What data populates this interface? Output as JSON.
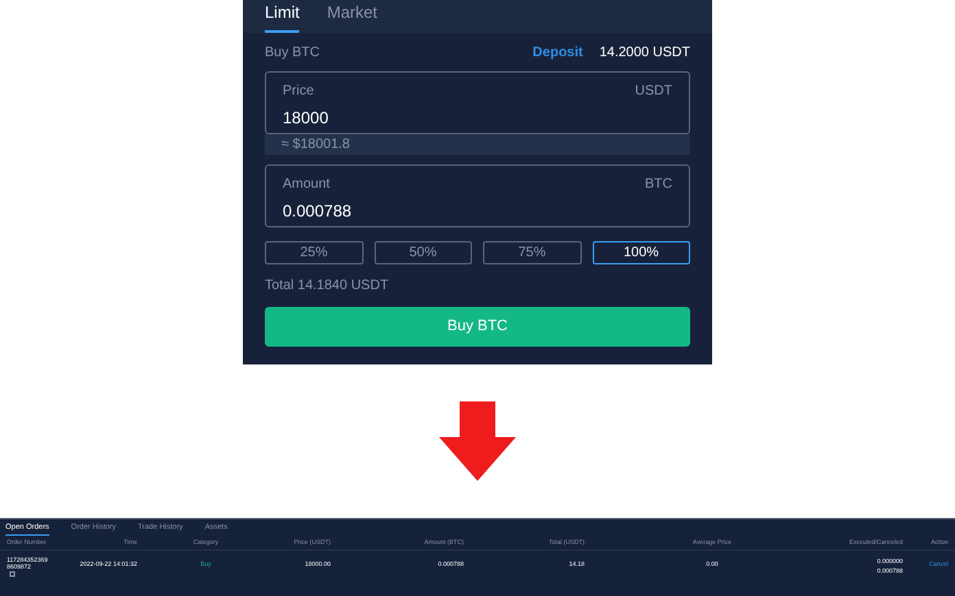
{
  "order_panel": {
    "tabs": [
      {
        "label": "Limit",
        "selected": true
      },
      {
        "label": "Market",
        "selected": false
      }
    ],
    "side_label": "Buy BTC",
    "deposit_link": "Deposit",
    "balance": "14.2000 USDT",
    "price_field": {
      "label": "Price",
      "value": "18000",
      "unit": "USDT"
    },
    "price_estimate": "≈ $18001.8",
    "amount_field": {
      "label": "Amount",
      "value": "0.000788",
      "unit": "BTC"
    },
    "percent_buttons": [
      {
        "label": "25%",
        "selected": false
      },
      {
        "label": "50%",
        "selected": false
      },
      {
        "label": "75%",
        "selected": false
      },
      {
        "label": "100%",
        "selected": true
      }
    ],
    "total": "Total 14.1840 USDT",
    "submit_button": "Buy BTC"
  },
  "orders_panel": {
    "tabs": [
      {
        "label": "Open Orders",
        "selected": true
      },
      {
        "label": "Order History",
        "selected": false
      },
      {
        "label": "Trade History",
        "selected": false
      },
      {
        "label": "Assets",
        "selected": false
      }
    ],
    "columns": [
      "Order Number",
      "Time",
      "Category",
      "Price (USDT)",
      "Amount (BTC)",
      "Total (USDT)",
      "Average Price",
      "Executed/Canceled",
      "Action"
    ],
    "rows": [
      {
        "order_number": "1172843523698609872",
        "time": "2022-09-22 14:01:32",
        "category": "Buy",
        "price": "18000.00",
        "amount": "0.000788",
        "total": "14.18",
        "average_price": "0.00",
        "executed": "0.000000",
        "canceled": "0.000788",
        "action": "Cancel"
      }
    ]
  }
}
